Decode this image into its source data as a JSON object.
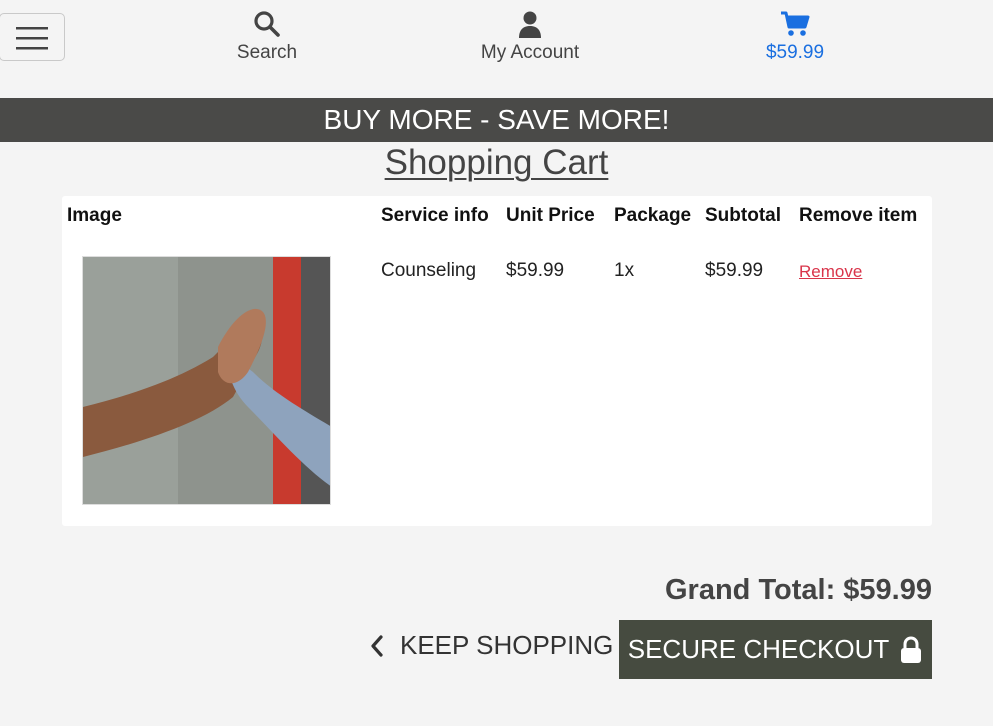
{
  "nav": {
    "menu_icon": "hamburger-icon",
    "search": {
      "label": "Search",
      "icon": "search-icon"
    },
    "account": {
      "label": "My Account",
      "icon": "user-icon"
    },
    "cart": {
      "label": "$59.99",
      "icon": "cart-icon",
      "color": "#1a6fe0"
    }
  },
  "promo": {
    "text": "BUY MORE - SAVE MORE!"
  },
  "page": {
    "title": "Shopping Cart"
  },
  "cart": {
    "columns": [
      "Image",
      "Service info",
      "Unit Price",
      "Package",
      "Subtotal",
      "Remove item"
    ],
    "items": [
      {
        "image": "product-photo-clasped-hands",
        "service": "Counseling",
        "unit_price": "$59.99",
        "package": "1x",
        "subtotal": "$59.99",
        "remove_label": "Remove"
      }
    ]
  },
  "summary": {
    "grand_total": "Grand Total: $59.99"
  },
  "actions": {
    "keep_shopping": "KEEP SHOPPING",
    "checkout": "SECURE CHECKOUT"
  },
  "colors": {
    "promo_bg": "#4a4a48",
    "checkout_bg": "#464b40",
    "remove": "#d9344a",
    "accent": "#1a6fe0"
  }
}
